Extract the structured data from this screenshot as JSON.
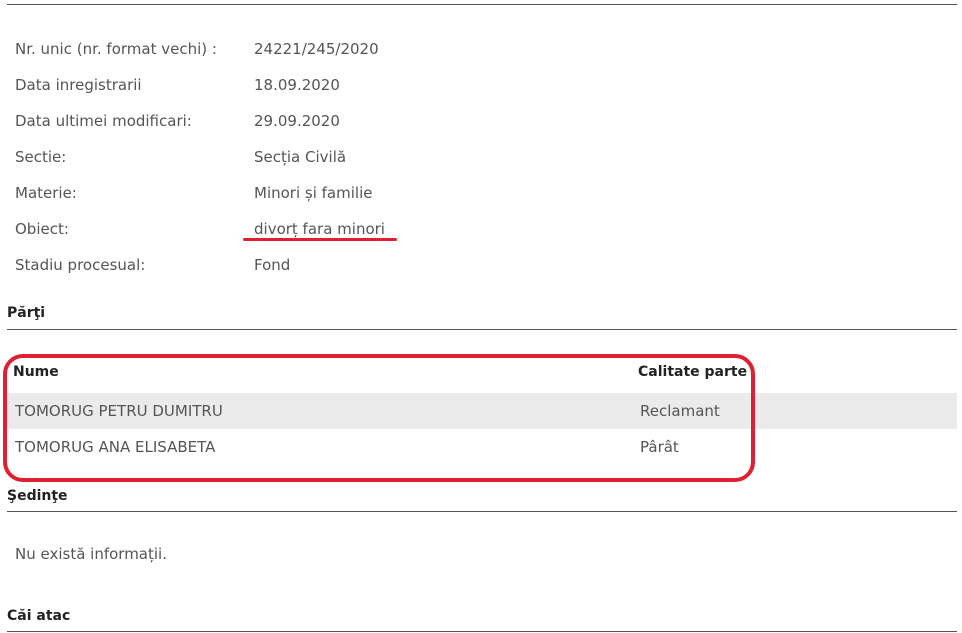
{
  "details": [
    {
      "label": "Nr. unic (nr. format vechi) :",
      "value": "24221/245/2020"
    },
    {
      "label": "Data inregistrarii",
      "value": "18.09.2020"
    },
    {
      "label": "Data ultimei modificari:",
      "value": "29.09.2020"
    },
    {
      "label": "Sectie:",
      "value": "Secția Civilă"
    },
    {
      "label": "Materie:",
      "value": "Minori și familie"
    },
    {
      "label": "Obiect:",
      "value": "divorț fara minori"
    },
    {
      "label": "Stadiu procesual:",
      "value": "Fond"
    }
  ],
  "parti": {
    "title": "Părţi",
    "columns": {
      "name": "Nume",
      "role": "Calitate parte"
    },
    "rows": [
      {
        "name": "TOMORUG PETRU DUMITRU",
        "role": "Reclamant"
      },
      {
        "name": "TOMORUG ANA ELISABETA",
        "role": "Pârât"
      }
    ]
  },
  "sedinte": {
    "title": "Şedinţe",
    "empty_message": "Nu există informații."
  },
  "cai_atac": {
    "title": "Căi atac"
  },
  "colors": {
    "highlight": "#e02030",
    "row_alt": "#ebebeb"
  }
}
